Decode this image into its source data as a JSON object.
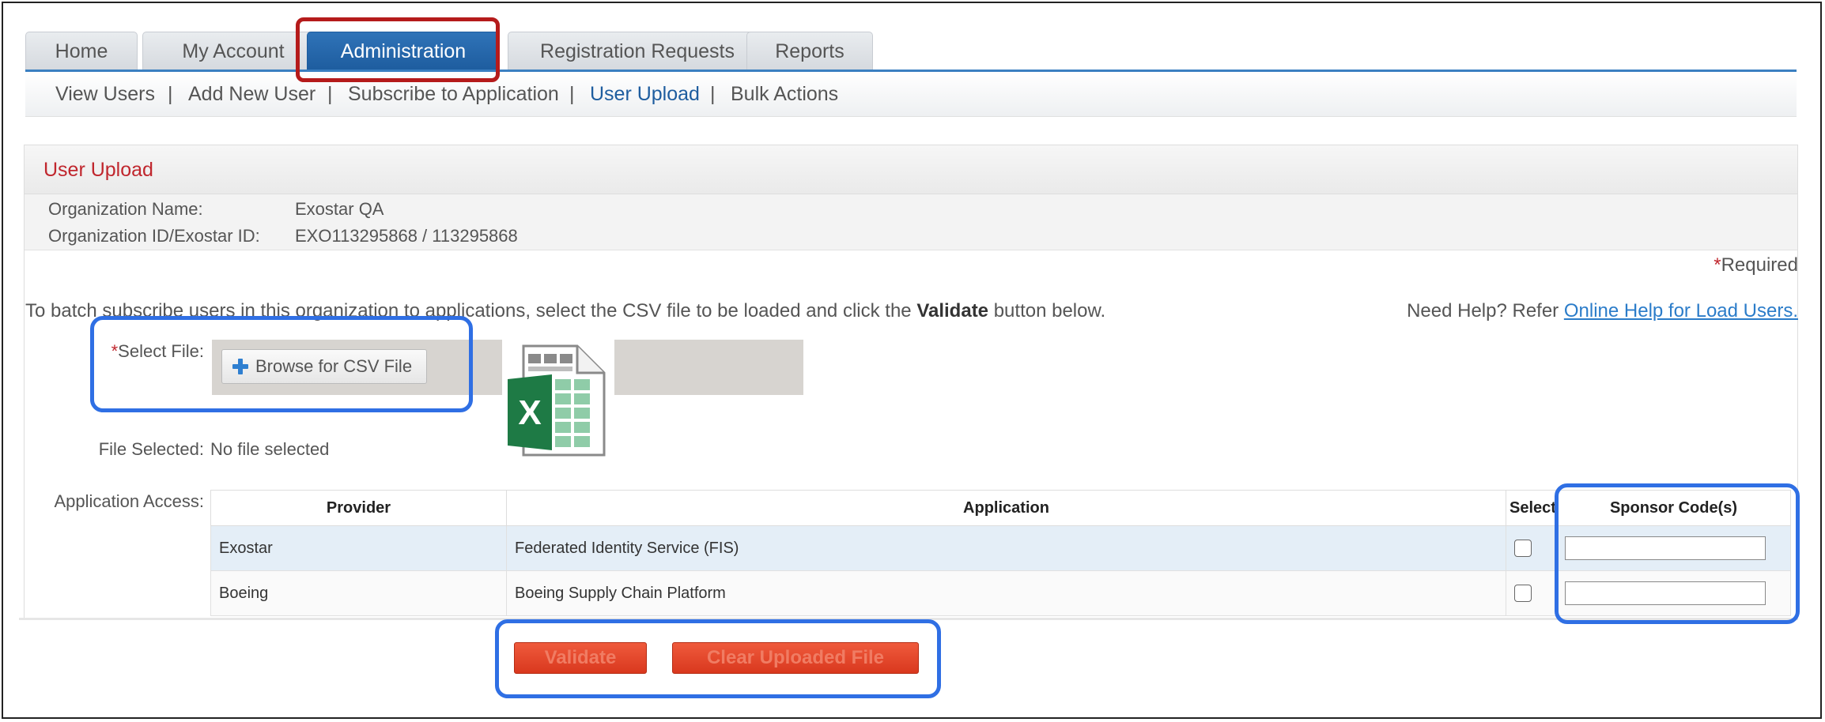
{
  "tabs": [
    "Home",
    "My Account",
    "Administration",
    "Registration Requests",
    "Reports"
  ],
  "active_tab": "Administration",
  "subnav": {
    "items": [
      "View Users",
      "Add New User",
      "Subscribe to Application",
      "User Upload",
      "Bulk Actions"
    ],
    "separator": "|",
    "current": "User Upload"
  },
  "panel": {
    "title": "User Upload",
    "org_name_label": "Organization Name:",
    "org_name_value": "Exostar QA",
    "org_id_label": "Organization ID/Exostar ID:",
    "org_id_value": "EXO113295868 / 113295868",
    "required_star": "*",
    "required_text": "Required",
    "instruction_pre": "To batch subscribe users in this organization to applications, select the CSV file to be loaded and click the ",
    "instruction_bold": "Validate",
    "instruction_post": " button below.",
    "help_text": "Need Help? Refer ",
    "help_link": "Online Help for Load Users.",
    "select_file_star": "*",
    "select_file_label": "Select File:",
    "browse_button": "Browse for CSV File",
    "file_selected_label": "File Selected:",
    "file_selected_value": "No file selected",
    "app_access_label": "Application Access:",
    "excel_letter": "X"
  },
  "table": {
    "headers": [
      "Provider",
      "Application",
      "Select",
      "Sponsor Code(s)"
    ],
    "rows": [
      {
        "provider": "Exostar",
        "application": "Federated Identity Service (FIS)",
        "selected": false,
        "sponsor_code": ""
      },
      {
        "provider": "Boeing",
        "application": "Boeing Supply Chain Platform",
        "selected": false,
        "sponsor_code": ""
      }
    ]
  },
  "buttons": {
    "validate": "Validate",
    "clear": "Clear Uploaded File"
  },
  "colors": {
    "tab_active": "#1e5d9f",
    "accent_link": "#2b7cc9",
    "required_red": "#c0262d",
    "button_red": "#e24a2c",
    "highlight_blue": "#2f6fe4",
    "highlight_red": "#b51b1b",
    "excel_green": "#1e7a45"
  }
}
